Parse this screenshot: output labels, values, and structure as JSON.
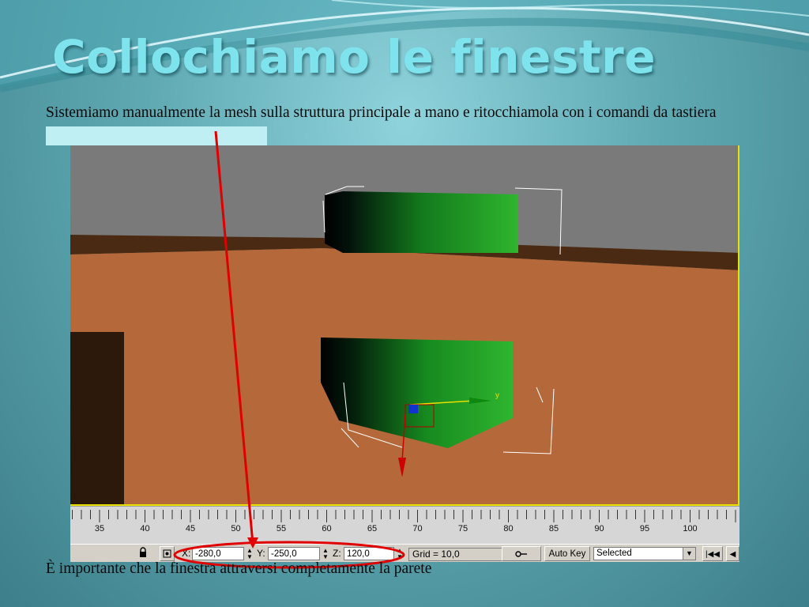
{
  "slide": {
    "title": "Collochiamo le finestre",
    "intro": "Sistemiamo manualmente la mesh sulla struttura principale a mano e ritocchiamola con i comandi da tastiera",
    "caption": "È importante che la finestra attraversi completamente la parete"
  },
  "viewport": {
    "axis_label_y": "y"
  },
  "ruler": {
    "ticks": [
      "35",
      "40",
      "45",
      "50",
      "55",
      "60",
      "65",
      "70",
      "75",
      "80",
      "85",
      "90",
      "95",
      "100"
    ]
  },
  "status": {
    "x_label": "X:",
    "x_value": "-280,0",
    "y_label": "Y:",
    "y_value": "-250,0",
    "z_label": "Z:",
    "z_value": "120,0",
    "grid": "Grid = 10,0",
    "auto_key": "Auto Key",
    "selected": "Selected"
  },
  "icons": {
    "lock": "lock-icon",
    "absolute_mode": "transform-mode-icon",
    "key": "key-icon",
    "go_to_start": "go-to-start-icon",
    "prev_frame": "previous-frame-icon"
  },
  "colors": {
    "title": "#7fe3ee",
    "annotation": "#e00000",
    "wall": "#b5693a",
    "window_mesh": "#1f9a1f",
    "viewport_border": "#e8e000"
  }
}
